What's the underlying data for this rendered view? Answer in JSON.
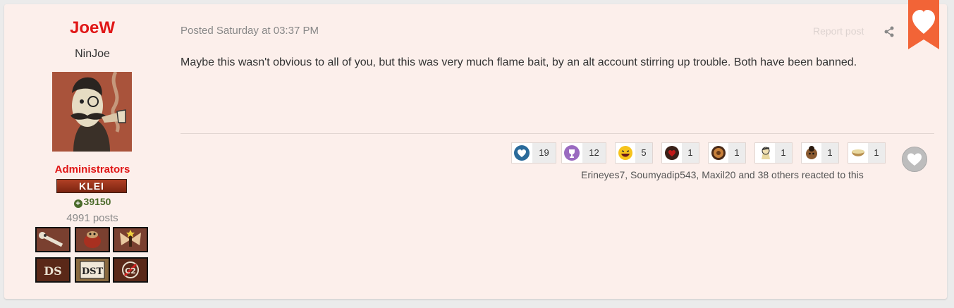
{
  "author": {
    "name": "JoeW",
    "title": "NinJoe",
    "group": "Administrators",
    "badge": "KLEI",
    "reputation": "39150",
    "posts": "4991 posts",
    "avatar_icon": "monocle-gentleman-avatar",
    "awards": [
      "bone-award-icon",
      "spider-award-icon",
      "fairy-award-icon",
      "ds-award-icon",
      "dst-award-icon",
      "no-entry-award-icon"
    ]
  },
  "post": {
    "meta": "Posted Saturday at 03:37 PM",
    "report": "Report post",
    "content": "Maybe this wasn't obvious to all of you, but this was very much flame bait, by an alt account stirring up trouble. Both have been banned."
  },
  "reactions": [
    {
      "icon": "heart-reaction-icon",
      "count": "19"
    },
    {
      "icon": "trophy-reaction-icon",
      "count": "12"
    },
    {
      "icon": "laugh-reaction-icon",
      "count": "5"
    },
    {
      "icon": "red-heart-reaction-icon",
      "count": "1"
    },
    {
      "icon": "medallion-reaction-icon",
      "count": "1"
    },
    {
      "icon": "character-reaction-icon",
      "count": "1"
    },
    {
      "icon": "face-reaction-icon",
      "count": "1"
    },
    {
      "icon": "bowl-reaction-icon",
      "count": "1"
    }
  ],
  "reacted_text": "Erineyes7, Soumyadip543, Maxil20 and 38 others reacted to this",
  "colors": {
    "accent": "#e01616",
    "ribbon": "#f26437",
    "background": "#fcefeb"
  }
}
